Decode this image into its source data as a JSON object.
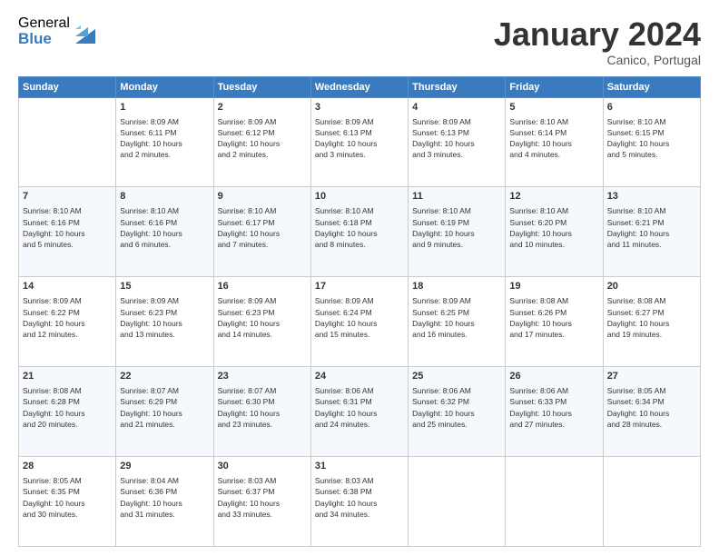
{
  "header": {
    "logo_general": "General",
    "logo_blue": "Blue",
    "title": "January 2024",
    "location": "Canico, Portugal"
  },
  "days_of_week": [
    "Sunday",
    "Monday",
    "Tuesday",
    "Wednesday",
    "Thursday",
    "Friday",
    "Saturday"
  ],
  "weeks": [
    [
      {
        "day": "",
        "info": ""
      },
      {
        "day": "1",
        "info": "Sunrise: 8:09 AM\nSunset: 6:11 PM\nDaylight: 10 hours\nand 2 minutes."
      },
      {
        "day": "2",
        "info": "Sunrise: 8:09 AM\nSunset: 6:12 PM\nDaylight: 10 hours\nand 2 minutes."
      },
      {
        "day": "3",
        "info": "Sunrise: 8:09 AM\nSunset: 6:13 PM\nDaylight: 10 hours\nand 3 minutes."
      },
      {
        "day": "4",
        "info": "Sunrise: 8:09 AM\nSunset: 6:13 PM\nDaylight: 10 hours\nand 3 minutes."
      },
      {
        "day": "5",
        "info": "Sunrise: 8:10 AM\nSunset: 6:14 PM\nDaylight: 10 hours\nand 4 minutes."
      },
      {
        "day": "6",
        "info": "Sunrise: 8:10 AM\nSunset: 6:15 PM\nDaylight: 10 hours\nand 5 minutes."
      }
    ],
    [
      {
        "day": "7",
        "info": "Sunrise: 8:10 AM\nSunset: 6:16 PM\nDaylight: 10 hours\nand 5 minutes."
      },
      {
        "day": "8",
        "info": "Sunrise: 8:10 AM\nSunset: 6:16 PM\nDaylight: 10 hours\nand 6 minutes."
      },
      {
        "day": "9",
        "info": "Sunrise: 8:10 AM\nSunset: 6:17 PM\nDaylight: 10 hours\nand 7 minutes."
      },
      {
        "day": "10",
        "info": "Sunrise: 8:10 AM\nSunset: 6:18 PM\nDaylight: 10 hours\nand 8 minutes."
      },
      {
        "day": "11",
        "info": "Sunrise: 8:10 AM\nSunset: 6:19 PM\nDaylight: 10 hours\nand 9 minutes."
      },
      {
        "day": "12",
        "info": "Sunrise: 8:10 AM\nSunset: 6:20 PM\nDaylight: 10 hours\nand 10 minutes."
      },
      {
        "day": "13",
        "info": "Sunrise: 8:10 AM\nSunset: 6:21 PM\nDaylight: 10 hours\nand 11 minutes."
      }
    ],
    [
      {
        "day": "14",
        "info": "Sunrise: 8:09 AM\nSunset: 6:22 PM\nDaylight: 10 hours\nand 12 minutes."
      },
      {
        "day": "15",
        "info": "Sunrise: 8:09 AM\nSunset: 6:23 PM\nDaylight: 10 hours\nand 13 minutes."
      },
      {
        "day": "16",
        "info": "Sunrise: 8:09 AM\nSunset: 6:23 PM\nDaylight: 10 hours\nand 14 minutes."
      },
      {
        "day": "17",
        "info": "Sunrise: 8:09 AM\nSunset: 6:24 PM\nDaylight: 10 hours\nand 15 minutes."
      },
      {
        "day": "18",
        "info": "Sunrise: 8:09 AM\nSunset: 6:25 PM\nDaylight: 10 hours\nand 16 minutes."
      },
      {
        "day": "19",
        "info": "Sunrise: 8:08 AM\nSunset: 6:26 PM\nDaylight: 10 hours\nand 17 minutes."
      },
      {
        "day": "20",
        "info": "Sunrise: 8:08 AM\nSunset: 6:27 PM\nDaylight: 10 hours\nand 19 minutes."
      }
    ],
    [
      {
        "day": "21",
        "info": "Sunrise: 8:08 AM\nSunset: 6:28 PM\nDaylight: 10 hours\nand 20 minutes."
      },
      {
        "day": "22",
        "info": "Sunrise: 8:07 AM\nSunset: 6:29 PM\nDaylight: 10 hours\nand 21 minutes."
      },
      {
        "day": "23",
        "info": "Sunrise: 8:07 AM\nSunset: 6:30 PM\nDaylight: 10 hours\nand 23 minutes."
      },
      {
        "day": "24",
        "info": "Sunrise: 8:06 AM\nSunset: 6:31 PM\nDaylight: 10 hours\nand 24 minutes."
      },
      {
        "day": "25",
        "info": "Sunrise: 8:06 AM\nSunset: 6:32 PM\nDaylight: 10 hours\nand 25 minutes."
      },
      {
        "day": "26",
        "info": "Sunrise: 8:06 AM\nSunset: 6:33 PM\nDaylight: 10 hours\nand 27 minutes."
      },
      {
        "day": "27",
        "info": "Sunrise: 8:05 AM\nSunset: 6:34 PM\nDaylight: 10 hours\nand 28 minutes."
      }
    ],
    [
      {
        "day": "28",
        "info": "Sunrise: 8:05 AM\nSunset: 6:35 PM\nDaylight: 10 hours\nand 30 minutes."
      },
      {
        "day": "29",
        "info": "Sunrise: 8:04 AM\nSunset: 6:36 PM\nDaylight: 10 hours\nand 31 minutes."
      },
      {
        "day": "30",
        "info": "Sunrise: 8:03 AM\nSunset: 6:37 PM\nDaylight: 10 hours\nand 33 minutes."
      },
      {
        "day": "31",
        "info": "Sunrise: 8:03 AM\nSunset: 6:38 PM\nDaylight: 10 hours\nand 34 minutes."
      },
      {
        "day": "",
        "info": ""
      },
      {
        "day": "",
        "info": ""
      },
      {
        "day": "",
        "info": ""
      }
    ]
  ]
}
